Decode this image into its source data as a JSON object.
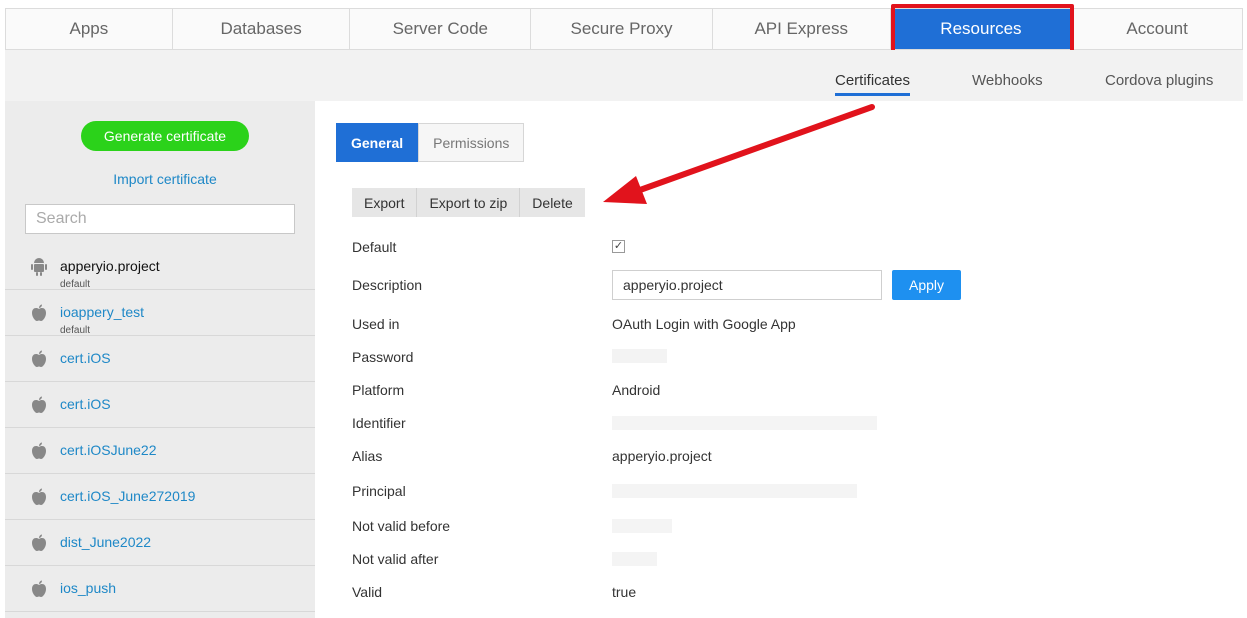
{
  "topnav": {
    "tabs": [
      {
        "label": "Apps"
      },
      {
        "label": "Databases"
      },
      {
        "label": "Server Code"
      },
      {
        "label": "Secure Proxy"
      },
      {
        "label": "API Express"
      },
      {
        "label": "Resources"
      },
      {
        "label": "Account"
      }
    ],
    "active_tab": "Resources"
  },
  "subnav": {
    "tabs": [
      {
        "label": "Certificates"
      },
      {
        "label": "Webhooks"
      },
      {
        "label": "Cordova plugins"
      }
    ],
    "active_tab": "Certificates"
  },
  "sidebar": {
    "generate_label": "Generate certificate",
    "import_label": "Import certificate",
    "search_placeholder": "Search",
    "items": [
      {
        "name": "apperyio.project",
        "sub": "default",
        "icon": "android-icon"
      },
      {
        "name": "ioappery_test",
        "sub": "default",
        "icon": "apple-icon"
      },
      {
        "name": "cert.iOS",
        "sub": "",
        "icon": "apple-icon"
      },
      {
        "name": "cert.iOS",
        "sub": "",
        "icon": "apple-icon"
      },
      {
        "name": "cert.iOSJune22",
        "sub": "",
        "icon": "apple-icon"
      },
      {
        "name": "cert.iOS_June272019",
        "sub": "",
        "icon": "apple-icon"
      },
      {
        "name": "dist_June2022",
        "sub": "",
        "icon": "apple-icon"
      },
      {
        "name": "ios_push",
        "sub": "",
        "icon": "apple-icon"
      }
    ]
  },
  "detail": {
    "tabs": [
      {
        "label": "General"
      },
      {
        "label": "Permissions"
      }
    ],
    "actions": [
      {
        "label": "Export"
      },
      {
        "label": "Export to zip"
      },
      {
        "label": "Delete"
      }
    ],
    "fields": {
      "default_label": "Default",
      "default_checked": true,
      "description_label": "Description",
      "description_value": "apperyio.project",
      "apply_label": "Apply",
      "used_in_label": "Used in",
      "used_in_value": "OAuth Login with Google App",
      "password_label": "Password",
      "platform_label": "Platform",
      "platform_value": "Android",
      "identifier_label": "Identifier",
      "alias_label": "Alias",
      "alias_value": "apperyio.project",
      "principal_label": "Principal",
      "not_valid_before_label": "Not valid before",
      "not_valid_after_label": "Not valid after",
      "valid_label": "Valid",
      "valid_value": "true"
    }
  },
  "colors": {
    "accent": "#1f6fd6",
    "highlight_box": "#e1131c",
    "arrow": "#e1131c",
    "generate_button": "#2bd21a",
    "link": "#1e88c7"
  }
}
